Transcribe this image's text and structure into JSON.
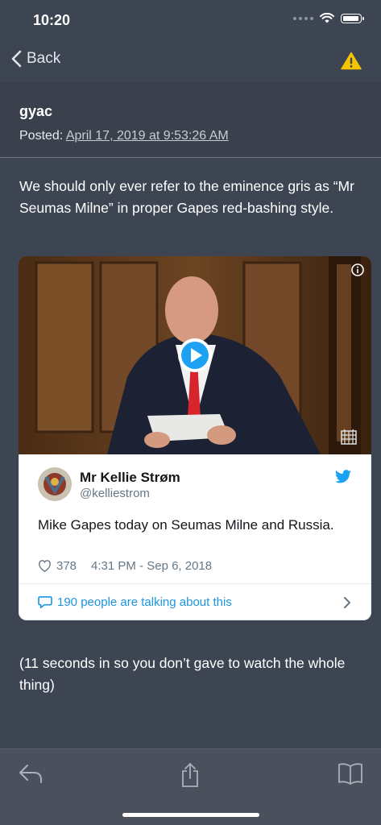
{
  "status_bar": {
    "time": "10:20"
  },
  "nav": {
    "back_label": "Back",
    "warning_icon": "warning-triangle-icon",
    "accent": "#f5c400"
  },
  "post": {
    "author": "gyac",
    "posted_label": "Posted:",
    "posted_date": "April 17, 2019 at 9:53:26 AM",
    "body": "We should only ever refer to the eminence gris as “Mr Seumas Milne” in proper Gapes red-bashing style.",
    "footnote": "(11 seconds in so you don’t gave to watch the whole thing)"
  },
  "tweet": {
    "name": "Mr Kellie Strøm",
    "handle": "@kelliestrom",
    "text": "Mike Gapes today on Seumas Milne and Russia.",
    "likes": "378",
    "timestamp": "4:31 PM - Sep 6, 2018",
    "talking": "190 people are talking about this",
    "accent": "#1da1f2"
  },
  "toolbar": {
    "icons": [
      "reply-icon",
      "share-icon",
      "book-icon"
    ]
  }
}
